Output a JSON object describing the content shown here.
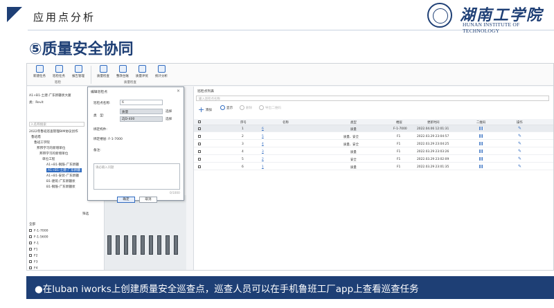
{
  "header": {
    "title": "应用点分析",
    "logo_cn": "湖南工学院",
    "logo_en": "HUNAN INSTITUTE OF TECHNOLOGY"
  },
  "section_title": "⑤质量安全协同",
  "ribbon": {
    "buttons": [
      "新建任务",
      "巡检任务",
      "报告管理",
      "质量检查",
      "整改台账",
      "质量评优",
      "统计分析"
    ],
    "groups": [
      "巡检",
      "质量检查"
    ]
  },
  "left_panel": {
    "tree": [
      "A1+B1-土建-广东新疆状大厦",
      "类：Revit",
      "2022年鲁班巡查管理BIM协议创作",
      "鲁班塔",
      "鲁班工学院",
      "邦邦学习的新增单位",
      "邦邦学习的新增单位",
      "单位工程",
      "A1+B1-钢筋-广东新疆",
      "A1+B1-土建-广东新疆",
      "A1+B1-安装-广东新疆",
      "B1-建筑-广东新疆状",
      "B1-钢筋-广东新疆状"
    ],
    "search_placeholder": "入名称搜索",
    "filter_label": "筛选",
    "checklist_header": "全部",
    "checklist": [
      "F-1-7000",
      "F-1-5600",
      "F-1",
      "F1",
      "F2",
      "F3",
      "F4"
    ]
  },
  "dialog": {
    "title": "编辑巡检点",
    "close": "×",
    "name_label": "巡检点名称:",
    "name_value": "6",
    "type_label": "类　型:",
    "type_value_1": "质量",
    "type_value_2": "ZJD-400",
    "pick": "选择",
    "component_label": "绑定构件:",
    "floor_label": "绑定楼层:",
    "floor_value": "F-1-7000",
    "remark_label": "备注:",
    "textarea_placeholder": "请必输入问题",
    "counter": "0/1000",
    "ok": "确定",
    "cancel": "取消"
  },
  "right_panel": {
    "title": "巡检点列表",
    "search_placeholder": "输入巡检点名称",
    "toolbar": {
      "add": "添加",
      "show": "显示",
      "delete": "删除",
      "export": "导出二维码"
    },
    "columns": [
      "序号",
      "名称",
      "类型",
      "楼层",
      "更新时间",
      "二维码",
      "操作"
    ],
    "rows": [
      {
        "no": "1",
        "name": "6",
        "type": "质量",
        "floor": "F-1-7000",
        "time": "2022.04.06 12:01:31"
      },
      {
        "no": "2",
        "name": "5",
        "type": "质量、安全",
        "floor": "F1",
        "time": "2022.03.29 23:04:57"
      },
      {
        "no": "3",
        "name": "4",
        "type": "质量、安全",
        "floor": "F1",
        "time": "2022.03.29 23:04:25"
      },
      {
        "no": "4",
        "name": "3",
        "type": "质量",
        "floor": "F1",
        "time": "2022.03.29 23:03:26"
      },
      {
        "no": "5",
        "name": "2",
        "type": "安全",
        "floor": "F1",
        "time": "2022.03.29 23:02:09"
      },
      {
        "no": "6",
        "name": "1",
        "type": "质量",
        "floor": "F1",
        "time": "2022.03.29 23:01:35"
      }
    ]
  },
  "banner": "●在luban iworks上创建质量安全巡查点，巡查人员可以在手机鲁班工厂app上查看巡查任务",
  "colors": {
    "brand": "#1e3f75",
    "accent": "#2f6bc0"
  }
}
